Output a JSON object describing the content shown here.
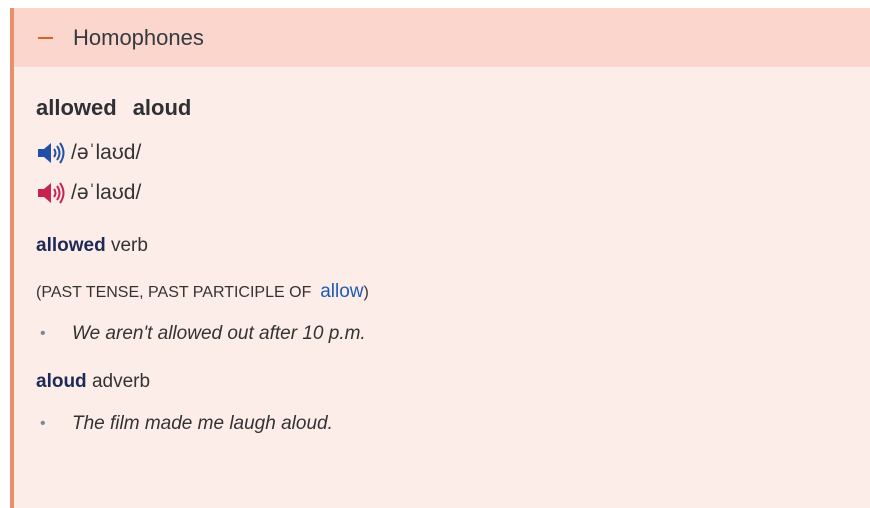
{
  "header": {
    "title": "Homophones"
  },
  "words": [
    "allowed",
    "aloud"
  ],
  "pronunciations": [
    {
      "ipa": "/əˈlaʊd/",
      "speaker_icon": "speaker-uk-icon",
      "color": "#1f4fa8"
    },
    {
      "ipa": "/əˈlaʊd/",
      "speaker_icon": "speaker-us-icon",
      "color": "#c8234f"
    }
  ],
  "entries": [
    {
      "headword": "allowed",
      "pos": "verb",
      "grammar_prefix": "(PAST TENSE, PAST PARTICIPLE OF",
      "grammar_link": "allow",
      "grammar_suffix": ")",
      "example": "We aren't allowed out after 10 p.m."
    },
    {
      "headword": "aloud",
      "pos": "adverb",
      "example": "The film made me laugh aloud."
    }
  ],
  "bullet": "•",
  "colors": {
    "accent": "#e8906d",
    "header_bg": "#fad6cc",
    "panel_bg": "#fcede8",
    "link": "#1f5bb5"
  }
}
